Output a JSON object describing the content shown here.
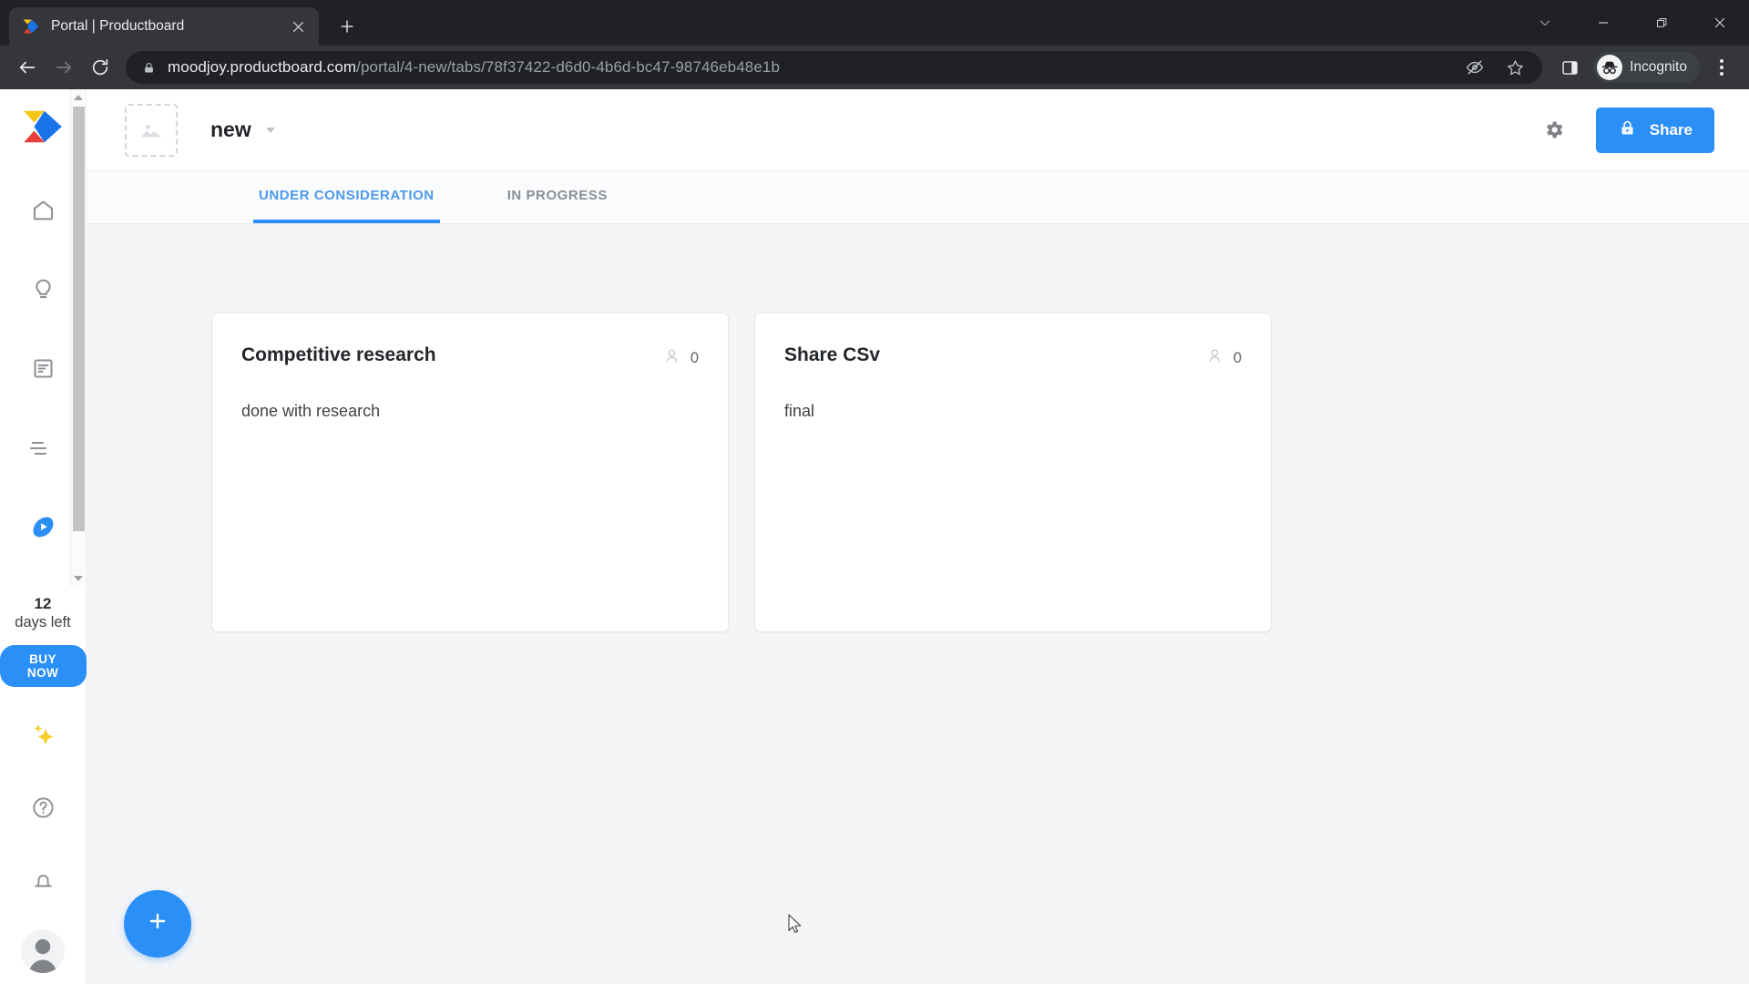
{
  "browser": {
    "tab": {
      "title": "Portal | Productboard",
      "favicon_icon": "productboard-logo-icon",
      "close_icon": "close-icon"
    },
    "new_tab_label": "+",
    "window_controls": [
      {
        "name": "minimize-to-tray",
        "icon": "chevron-down-icon",
        "glyph": "⌄"
      },
      {
        "name": "minimize",
        "icon": "minimize-icon",
        "glyph": "—"
      },
      {
        "name": "maximize",
        "icon": "restore-icon",
        "glyph": "❐"
      },
      {
        "name": "close",
        "icon": "close-icon",
        "glyph": "✕"
      }
    ],
    "toolbar": {
      "back_icon": "back-arrow-icon",
      "forward_icon": "forward-arrow-icon",
      "reload_icon": "reload-icon",
      "lock_icon": "lock-icon",
      "url_host": "moodjoy.productboard.com",
      "url_path": "/portal/4-new/tabs/78f37422-d6d0-4b6d-bc47-98746eb48e1b",
      "third_party_cookie_icon": "eye-slash-icon",
      "bookmark_icon": "star-icon",
      "side_panel_icon": "side-panel-icon",
      "incognito_label": "Incognito",
      "incognito_icon": "incognito-icon",
      "menu_icon": "three-dots-icon"
    }
  },
  "rail": {
    "logo_icon": "productboard-logo-icon",
    "items": [
      {
        "name": "sidebar-item-home",
        "icon": "home-icon",
        "active": false
      },
      {
        "name": "sidebar-item-insights",
        "icon": "lightbulb-icon",
        "active": false
      },
      {
        "name": "sidebar-item-features",
        "icon": "document-icon",
        "active": false
      },
      {
        "name": "sidebar-item-roadmaps",
        "icon": "lines-icon",
        "active": false
      },
      {
        "name": "sidebar-item-portal",
        "icon": "portal-icon",
        "active": true
      }
    ],
    "trial": {
      "days": "12",
      "label": "days left",
      "buy_now_label": "BUY NOW"
    },
    "bottom_items": [
      {
        "name": "sidebar-item-whats-new",
        "icon": "sparkle-icon"
      },
      {
        "name": "sidebar-item-help",
        "icon": "question-circle-icon"
      },
      {
        "name": "sidebar-item-notifications",
        "icon": "bell-icon"
      }
    ],
    "avatar_icon": "user-avatar-icon"
  },
  "portal": {
    "thumbnail_icon": "image-placeholder-icon",
    "title": "new",
    "title_caret_icon": "chevron-down-icon",
    "settings_icon": "gear-icon",
    "share": {
      "label": "Share",
      "icon": "lock-icon"
    },
    "tabs": [
      {
        "label": "UNDER CONSIDERATION",
        "active": true
      },
      {
        "label": "IN PROGRESS",
        "active": false
      }
    ],
    "cards": [
      {
        "title": "Competitive research",
        "description": "done with research",
        "votes": "0",
        "votes_icon": "person-icon"
      },
      {
        "title": "Share CSv",
        "description": "final",
        "votes": "0",
        "votes_icon": "person-icon"
      }
    ],
    "add_button": {
      "label": "+",
      "icon": "plus-icon"
    }
  },
  "colors": {
    "accent": "#2a8ff7",
    "tab_active": "#4c9aee",
    "page_bg": "#f4f5f7",
    "chrome_dark": "#202124",
    "chrome_toolbar": "#35363a",
    "buy_now": "#2a8ff7"
  }
}
